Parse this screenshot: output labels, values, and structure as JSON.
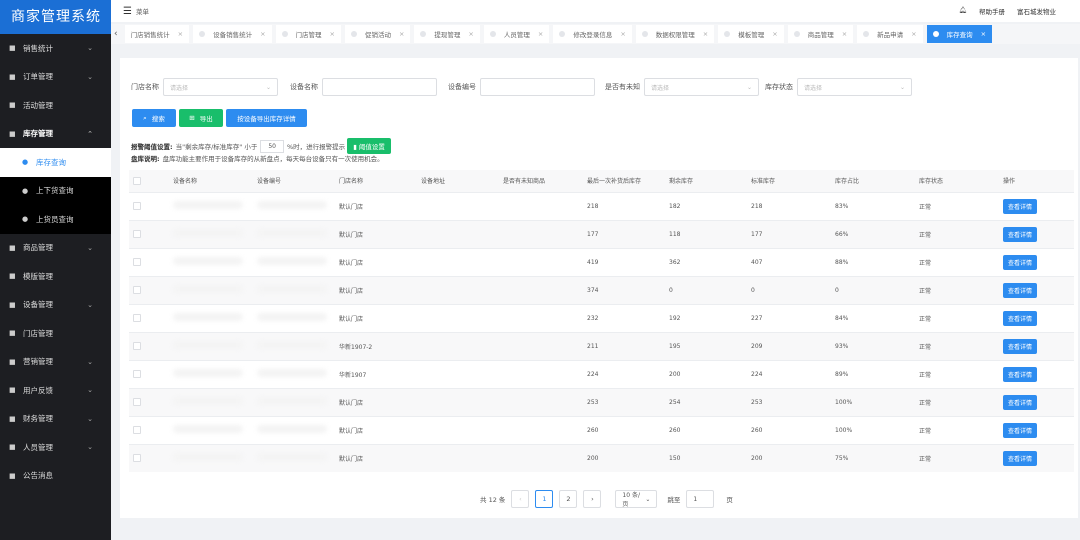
{
  "app_title": "商家管理系统",
  "sidebar": {
    "items": [
      {
        "label": "销售统计",
        "icon": "clock-icon",
        "expandable": true
      },
      {
        "label": "订单管理",
        "icon": "order-icon",
        "expandable": true
      },
      {
        "label": "活动管理",
        "icon": "activity-icon",
        "expandable": false
      },
      {
        "label": "库存管理",
        "icon": "inventory-icon",
        "expandable": true,
        "open": true
      },
      {
        "label": "库存查询",
        "sub": true,
        "active": true
      },
      {
        "label": "上下货查询",
        "sub": true
      },
      {
        "label": "上货员查询",
        "sub": true
      },
      {
        "label": "商品管理",
        "icon": "cart-icon",
        "expandable": true
      },
      {
        "label": "模版管理",
        "icon": "template-icon",
        "expandable": false
      },
      {
        "label": "设备管理",
        "icon": "device-icon",
        "expandable": true
      },
      {
        "label": "门店管理",
        "icon": "store-icon",
        "expandable": false
      },
      {
        "label": "营销管理",
        "icon": "marketing-icon",
        "expandable": true
      },
      {
        "label": "用户反馈",
        "icon": "feedback-icon",
        "expandable": true
      },
      {
        "label": "财务管理",
        "icon": "finance-icon",
        "expandable": true
      },
      {
        "label": "人员管理",
        "icon": "people-icon",
        "expandable": true
      },
      {
        "label": "公告消息",
        "icon": "notice-icon",
        "expandable": false
      }
    ]
  },
  "topbar": {
    "menu_label": "菜单",
    "help": "帮助手册",
    "user": "富石城发物业"
  },
  "tabs": [
    "门店销售统计",
    "设备销售统计",
    "门店管理",
    "促销活动",
    "提现管理",
    "人员管理",
    "修改登录信息",
    "数据权限管理",
    "模板管理",
    "商品管理",
    "新品申请",
    "库存查询"
  ],
  "active_tab": 11,
  "filters": {
    "store_label": "门店名称",
    "store_placeholder": "请选择",
    "device_name_label": "设备名称",
    "device_name_value": "",
    "device_code_label": "设备编号",
    "device_code_value": "",
    "unknown_label": "是否有未知",
    "unknown_placeholder": "请选择",
    "stock_status_label": "库存状态",
    "stock_status_placeholder": "请选择"
  },
  "buttons": {
    "search": "搜索",
    "export": "导出",
    "export_by_device": "按设备导出库存详情",
    "threshold": "阈值设置",
    "view": "查看详情"
  },
  "alert": {
    "title": "报警阈值设置:",
    "text1": "当\"剩余库存/标准库存\" 小于",
    "value": "50",
    "text2": "%时，进行报警提示"
  },
  "inventory_note": {
    "title": "盘库说明:",
    "text": "盘库功能主要作用于设备库存的从新盘点，每天每台设备只有一次使用机会。"
  },
  "table": {
    "columns": [
      "设备名称",
      "设备编号",
      "门店名称",
      "设备地址",
      "是否有未知商品",
      "最后一次补货后库存",
      "剩余库存",
      "标准库存",
      "库存占比",
      "库存状态",
      "操作"
    ],
    "rows": [
      [
        "",
        "",
        "默认门店",
        "",
        "",
        "218",
        "182",
        "218",
        "83%",
        "正常"
      ],
      [
        "",
        "",
        "默认门店",
        "",
        "",
        "177",
        "118",
        "177",
        "66%",
        "正常"
      ],
      [
        "",
        "",
        "默认门店",
        "",
        "",
        "419",
        "362",
        "407",
        "88%",
        "正常"
      ],
      [
        "",
        "",
        "默认门店",
        "",
        "",
        "374",
        "0",
        "0",
        "0",
        "正常"
      ],
      [
        "",
        "",
        "默认门店",
        "",
        "",
        "232",
        "192",
        "227",
        "84%",
        "正常"
      ],
      [
        "",
        "",
        "华新1907-2",
        "",
        "",
        "211",
        "195",
        "209",
        "93%",
        "正常"
      ],
      [
        "",
        "",
        "华新1907",
        "",
        "",
        "224",
        "200",
        "224",
        "89%",
        "正常"
      ],
      [
        "",
        "",
        "默认门店",
        "",
        "",
        "253",
        "254",
        "253",
        "100%",
        "正常"
      ],
      [
        "",
        "",
        "默认门店",
        "",
        "",
        "260",
        "260",
        "260",
        "100%",
        "正常"
      ],
      [
        "",
        "",
        "默认门店",
        "",
        "",
        "200",
        "150",
        "200",
        "75%",
        "正常"
      ]
    ]
  },
  "pagination": {
    "total": "共 12 条",
    "pages": [
      "1",
      "2"
    ],
    "current": "1",
    "page_size": "10 条/页",
    "jump_label": "跳至",
    "jump_value": "1",
    "page_suffix": "页"
  },
  "colors": {
    "brand": "#1b6fd5",
    "primary": "#2d8cf0",
    "success": "#19be6b"
  }
}
